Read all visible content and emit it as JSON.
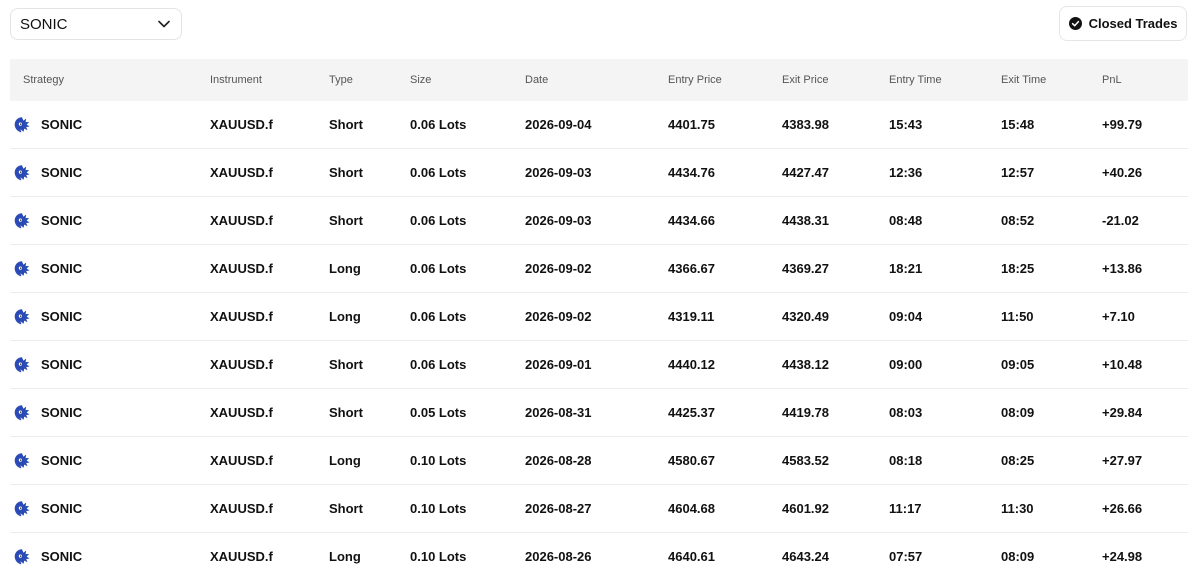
{
  "filter": {
    "strategy_value": "SONIC"
  },
  "actions": {
    "closed_trades_label": "Closed Trades"
  },
  "table": {
    "headers": [
      "Strategy",
      "Instrument",
      "Type",
      "Size",
      "Date",
      "Entry Price",
      "Exit Price",
      "Entry Time",
      "Exit Time",
      "PnL"
    ],
    "rows": [
      {
        "strategy": "SONIC",
        "instrument": "XAUUSD.f",
        "type": "Short",
        "size": "0.06 Lots",
        "date": "2026-09-04",
        "entry_price": "4401.75",
        "exit_price": "4383.98",
        "entry_time": "15:43",
        "exit_time": "15:48",
        "pnl": "+99.79"
      },
      {
        "strategy": "SONIC",
        "instrument": "XAUUSD.f",
        "type": "Short",
        "size": "0.06 Lots",
        "date": "2026-09-03",
        "entry_price": "4434.76",
        "exit_price": "4427.47",
        "entry_time": "12:36",
        "exit_time": "12:57",
        "pnl": "+40.26"
      },
      {
        "strategy": "SONIC",
        "instrument": "XAUUSD.f",
        "type": "Short",
        "size": "0.06 Lots",
        "date": "2026-09-03",
        "entry_price": "4434.66",
        "exit_price": "4438.31",
        "entry_time": "08:48",
        "exit_time": "08:52",
        "pnl": "-21.02"
      },
      {
        "strategy": "SONIC",
        "instrument": "XAUUSD.f",
        "type": "Long",
        "size": "0.06 Lots",
        "date": "2026-09-02",
        "entry_price": "4366.67",
        "exit_price": "4369.27",
        "entry_time": "18:21",
        "exit_time": "18:25",
        "pnl": "+13.86"
      },
      {
        "strategy": "SONIC",
        "instrument": "XAUUSD.f",
        "type": "Long",
        "size": "0.06 Lots",
        "date": "2026-09-02",
        "entry_price": "4319.11",
        "exit_price": "4320.49",
        "entry_time": "09:04",
        "exit_time": "11:50",
        "pnl": "+7.10"
      },
      {
        "strategy": "SONIC",
        "instrument": "XAUUSD.f",
        "type": "Short",
        "size": "0.06 Lots",
        "date": "2026-09-01",
        "entry_price": "4440.12",
        "exit_price": "4438.12",
        "entry_time": "09:00",
        "exit_time": "09:05",
        "pnl": "+10.48"
      },
      {
        "strategy": "SONIC",
        "instrument": "XAUUSD.f",
        "type": "Short",
        "size": "0.05 Lots",
        "date": "2026-08-31",
        "entry_price": "4425.37",
        "exit_price": "4419.78",
        "entry_time": "08:03",
        "exit_time": "08:09",
        "pnl": "+29.84"
      },
      {
        "strategy": "SONIC",
        "instrument": "XAUUSD.f",
        "type": "Long",
        "size": "0.10 Lots",
        "date": "2026-08-28",
        "entry_price": "4580.67",
        "exit_price": "4583.52",
        "entry_time": "08:18",
        "exit_time": "08:25",
        "pnl": "+27.97"
      },
      {
        "strategy": "SONIC",
        "instrument": "XAUUSD.f",
        "type": "Short",
        "size": "0.10 Lots",
        "date": "2026-08-27",
        "entry_price": "4604.68",
        "exit_price": "4601.92",
        "entry_time": "11:17",
        "exit_time": "11:30",
        "pnl": "+26.66"
      },
      {
        "strategy": "SONIC",
        "instrument": "XAUUSD.f",
        "type": "Long",
        "size": "0.10 Lots",
        "date": "2026-08-26",
        "entry_price": "4640.61",
        "exit_price": "4643.24",
        "entry_time": "07:57",
        "exit_time": "08:09",
        "pnl": "+24.98"
      }
    ]
  },
  "icons": {
    "dropdown": "chevron-down-icon",
    "closed_trades": "check-circle-icon",
    "strategy_logo": "sonic-logo-icon"
  },
  "colors": {
    "pnl_positive": "#5aa023",
    "pnl_negative": "#e5484d",
    "logo": "#2a4bb5",
    "header_bg": "#f4f4f4"
  }
}
